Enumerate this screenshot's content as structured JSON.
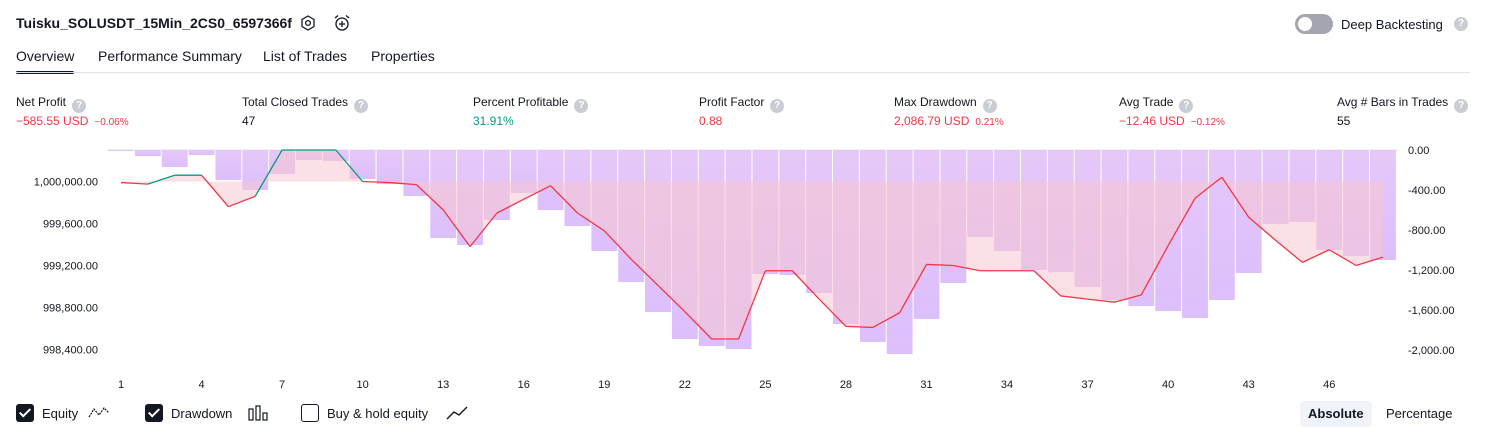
{
  "header": {
    "strategy_title": "Tuisku_SOLUSDT_15Min_2CS0_6597366f",
    "settings_icon": "gear-icon",
    "alert_icon": "alarm-clock-plus-icon",
    "deep_backtesting_label": "Deep Backtesting",
    "deep_backtesting_enabled": false,
    "help_glyph": "?"
  },
  "tabs": [
    {
      "label": "Overview",
      "active": true
    },
    {
      "label": "Performance Summary",
      "active": false
    },
    {
      "label": "List of Trades",
      "active": false
    },
    {
      "label": "Properties",
      "active": false
    }
  ],
  "metrics": [
    {
      "label": "Net Profit",
      "value": "−585.55 USD",
      "pct": "−0.06%",
      "color": "red"
    },
    {
      "label": "Total Closed Trades",
      "value": "47",
      "pct": "",
      "color": "dark"
    },
    {
      "label": "Percent Profitable",
      "value": "31.91%",
      "pct": "",
      "color": "green"
    },
    {
      "label": "Profit Factor",
      "value": "0.88",
      "pct": "",
      "color": "red"
    },
    {
      "label": "Max Drawdown",
      "value": "2,086.79 USD",
      "pct": "0.21%",
      "color": "red"
    },
    {
      "label": "Avg Trade",
      "value": "−12.46 USD",
      "pct": "−0.12%",
      "color": "red"
    },
    {
      "label": "Avg # Bars in Trades",
      "value": "55",
      "pct": "",
      "color": "dark"
    }
  ],
  "chart_data": {
    "type": "line",
    "x_ticks": [
      "1",
      "4",
      "7",
      "10",
      "13",
      "16",
      "19",
      "22",
      "25",
      "28",
      "31",
      "34",
      "37",
      "40",
      "43",
      "46"
    ],
    "left_axis_ticks": [
      "1,000,000.00",
      "999,600.00",
      "999,200.00",
      "998,800.00",
      "998,400.00"
    ],
    "right_axis_ticks": [
      "0.00",
      "-400.00",
      "-800.00",
      "-1,200.00",
      "-1,600.00",
      "-2,000.00"
    ],
    "left_ylim": [
      998300,
      1000300
    ],
    "right_ylim": [
      -2100,
      0
    ],
    "colors": {
      "equity_down": "#f23645",
      "equity_up": "#089981",
      "drawdown": "#b388ff"
    },
    "series": [
      {
        "name": "Equity",
        "x": [
          1,
          2,
          3,
          4,
          5,
          6,
          7,
          8,
          9,
          10,
          11,
          12,
          13,
          14,
          15,
          16,
          17,
          18,
          19,
          20,
          21,
          22,
          23,
          24,
          25,
          26,
          27,
          28,
          29,
          30,
          31,
          32,
          33,
          34,
          35,
          36,
          37,
          38,
          39,
          40,
          41,
          42,
          43,
          44,
          45,
          46,
          47,
          48
        ],
        "values": [
          999990,
          999975,
          1000060,
          1000060,
          999760,
          999860,
          1000300,
          1000300,
          1000300,
          1000000,
          999990,
          999970,
          999730,
          999380,
          999700,
          999830,
          999960,
          999700,
          999530,
          999260,
          999010,
          998760,
          998500,
          998500,
          999150,
          999150,
          998880,
          998620,
          998610,
          998750,
          999210,
          999200,
          999150,
          999150,
          999150,
          998910,
          998880,
          998850,
          998920,
          999390,
          999840,
          1000040,
          999660,
          999440,
          999230,
          999350,
          999200,
          999280
        ]
      },
      {
        "name": "Drawdown",
        "x": [
          1,
          2,
          3,
          4,
          5,
          6,
          7,
          8,
          9,
          10,
          11,
          12,
          13,
          14,
          15,
          16,
          17,
          18,
          19,
          20,
          21,
          22,
          23,
          24,
          25,
          26,
          27,
          28,
          29,
          30,
          31,
          32,
          33,
          34,
          35,
          36,
          37,
          38,
          39,
          40,
          41,
          42,
          43,
          44,
          45,
          46,
          47,
          48
        ],
        "values": [
          -10,
          -60,
          -170,
          -50,
          -300,
          -400,
          -240,
          -100,
          -110,
          -290,
          -340,
          -460,
          -880,
          -950,
          -700,
          -430,
          -600,
          -760,
          -1010,
          -1320,
          -1620,
          -1890,
          -1960,
          -1990,
          -1240,
          -1250,
          -1430,
          -1740,
          -1920,
          -2040,
          -1690,
          -1330,
          -870,
          -1010,
          -1200,
          -1220,
          -1370,
          -1500,
          -1560,
          -1610,
          -1680,
          -1500,
          -1230,
          -740,
          -720,
          -1000,
          -1060,
          -1100
        ]
      },
      {
        "name": "Buy & hold equity",
        "x": [],
        "values": []
      }
    ]
  },
  "legend": {
    "equity_label": "Equity",
    "equity_checked": true,
    "equity_icon": "equity-line-icon",
    "drawdown_label": "Drawdown",
    "drawdown_checked": true,
    "drawdown_icon": "drawdown-bars-icon",
    "buyhold_label": "Buy & hold equity",
    "buyhold_checked": false,
    "buyhold_icon": "buy-hold-line-icon"
  },
  "scale_toggle": {
    "absolute_label": "Absolute",
    "percentage_label": "Percentage",
    "selected": "Absolute"
  }
}
